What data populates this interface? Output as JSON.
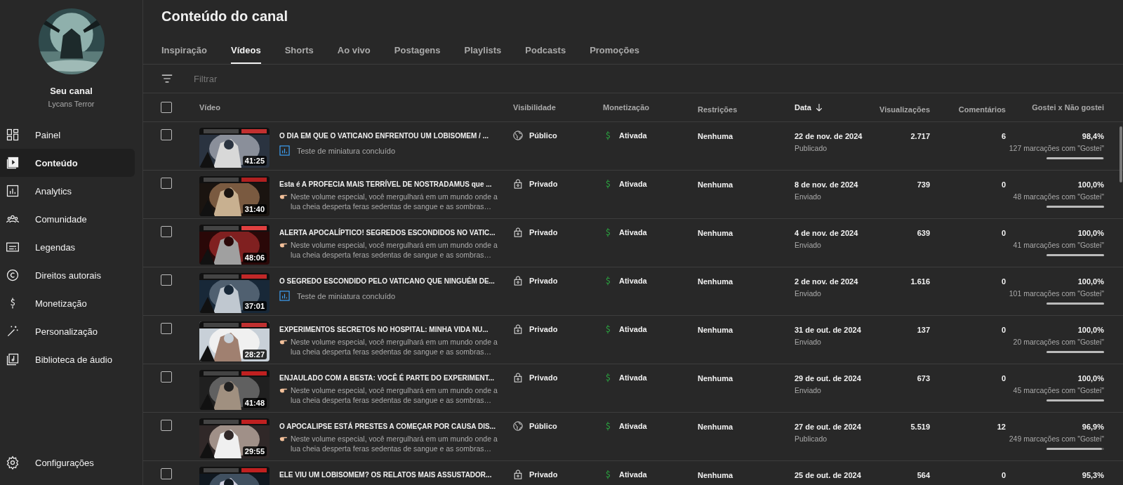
{
  "channel": {
    "label": "Seu canal",
    "name": "Lycans Terror"
  },
  "nav": [
    {
      "label": "Painel",
      "kind": "dashboard",
      "selected": false
    },
    {
      "label": "Conteúdo",
      "kind": "content",
      "selected": true
    },
    {
      "label": "Analytics",
      "kind": "analytics",
      "selected": false
    },
    {
      "label": "Comunidade",
      "kind": "community",
      "selected": false
    },
    {
      "label": "Legendas",
      "kind": "subtitles",
      "selected": false
    },
    {
      "label": "Direitos autorais",
      "kind": "copyright",
      "selected": false
    },
    {
      "label": "Monetização",
      "kind": "money",
      "selected": false
    },
    {
      "label": "Personalização",
      "kind": "wand",
      "selected": false
    },
    {
      "label": "Biblioteca de áudio",
      "kind": "audio",
      "selected": false
    }
  ],
  "settings": {
    "label": "Configurações"
  },
  "page_title": "Conteúdo do canal",
  "tabs": [
    {
      "label": "Inspiração",
      "selected": false
    },
    {
      "label": "Vídeos",
      "selected": true
    },
    {
      "label": "Shorts",
      "selected": false
    },
    {
      "label": "Ao vivo",
      "selected": false
    },
    {
      "label": "Postagens",
      "selected": false
    },
    {
      "label": "Playlists",
      "selected": false
    },
    {
      "label": "Podcasts",
      "selected": false
    },
    {
      "label": "Promoções",
      "selected": false
    }
  ],
  "filter": {
    "placeholder": "Filtrar"
  },
  "table": {
    "header_checked": false,
    "columns": [
      {
        "label": "Vídeo",
        "sorted": false
      },
      {
        "label": "Visibilidade",
        "sorted": false
      },
      {
        "label": "Monetização",
        "sorted": false
      },
      {
        "label": "Restrições",
        "sorted": false
      },
      {
        "label": "Data",
        "sorted": true
      },
      {
        "label": "Visualizações",
        "sorted": false
      },
      {
        "label": "Comentários",
        "sorted": false
      },
      {
        "label": "Gostei x Não gostei",
        "sorted": false
      }
    ],
    "rows": [
      {
        "checked": false,
        "duration": "41:25",
        "title": "O DIA EM QUE O VATICANO ENFRENTOU UM LOBISOMEM / ...",
        "sub": {
          "kind": "test",
          "text": "Teste de miniatura concluído"
        },
        "visibility": {
          "kind": "public",
          "label": "Público"
        },
        "monetization": "Ativada",
        "restrictions": "Nenhuma",
        "date": "22 de nov. de 2024",
        "status": "Publicado",
        "views": "2.717",
        "comments": "6",
        "likes_pct": "98,4%",
        "likes_count": "127 marcações com \"Gostei\"",
        "level": 0.984
      },
      {
        "checked": false,
        "duration": "31:40",
        "title": "Esta é A PROFECIA MAIS TERRÍVEL DE NOSTRADAMUS que ...",
        "sub": {
          "kind": "description",
          "text": "Neste volume especial, você mergulhará em um mundo onde a lua cheia desperta feras sedentas de sangue e as sombras…"
        },
        "visibility": {
          "kind": "private",
          "label": "Privado"
        },
        "monetization": "Ativada",
        "restrictions": "Nenhuma",
        "date": "8 de nov. de 2024",
        "status": "Enviado",
        "views": "739",
        "comments": "0",
        "likes_pct": "100,0%",
        "likes_count": "48 marcações com \"Gostei\"",
        "level": 1
      },
      {
        "checked": false,
        "duration": "48:06",
        "title": "ALERTA APOCALÍPTICO! SEGREDOS ESCONDIDOS NO VATIC...",
        "sub": {
          "kind": "description",
          "text": "Neste volume especial, você mergulhará em um mundo onde a lua cheia desperta feras sedentas de sangue e as sombras…"
        },
        "visibility": {
          "kind": "private",
          "label": "Privado"
        },
        "monetization": "Ativada",
        "restrictions": "Nenhuma",
        "date": "4 de nov. de 2024",
        "status": "Enviado",
        "views": "639",
        "comments": "0",
        "likes_pct": "100,0%",
        "likes_count": "41 marcações com \"Gostei\"",
        "level": 1
      },
      {
        "checked": false,
        "duration": "37:01",
        "title": "O SEGREDO ESCONDIDO PELO VATICANO QUE NINGUÉM DE...",
        "sub": {
          "kind": "test",
          "text": "Teste de miniatura concluído"
        },
        "visibility": {
          "kind": "private",
          "label": "Privado"
        },
        "monetization": "Ativada",
        "restrictions": "Nenhuma",
        "date": "2 de nov. de 2024",
        "status": "Enviado",
        "views": "1.616",
        "comments": "0",
        "likes_pct": "100,0%",
        "likes_count": "101 marcações com \"Gostei\"",
        "level": 1
      },
      {
        "checked": false,
        "duration": "28:27",
        "title": "EXPERIMENTOS SECRETOS NO HOSPITAL: MINHA VIDA NU...",
        "sub": {
          "kind": "description",
          "text": "Neste volume especial, você mergulhará em um mundo onde a lua cheia desperta feras sedentas de sangue e as sombras…"
        },
        "visibility": {
          "kind": "private",
          "label": "Privado"
        },
        "monetization": "Ativada",
        "restrictions": "Nenhuma",
        "date": "31 de out. de 2024",
        "status": "Enviado",
        "views": "137",
        "comments": "0",
        "likes_pct": "100,0%",
        "likes_count": "20 marcações com \"Gostei\"",
        "level": 1
      },
      {
        "checked": false,
        "duration": "41:48",
        "title": "ENJAULADO COM A BESTA: VOCÊ É PARTE DO EXPERIMENT...",
        "sub": {
          "kind": "description",
          "text": "Neste volume especial, você mergulhará em um mundo onde a lua cheia desperta feras sedentas de sangue e as sombras…"
        },
        "visibility": {
          "kind": "private",
          "label": "Privado"
        },
        "monetization": "Ativada",
        "restrictions": "Nenhuma",
        "date": "29 de out. de 2024",
        "status": "Enviado",
        "views": "673",
        "comments": "0",
        "likes_pct": "100,0%",
        "likes_count": "45 marcações com \"Gostei\"",
        "level": 1
      },
      {
        "checked": false,
        "duration": "29:55",
        "title": "O APOCALIPSE ESTÁ PRESTES A COMEÇAR POR CAUSA DIS...",
        "sub": {
          "kind": "description",
          "text": "Neste volume especial, você mergulhará em um mundo onde a lua cheia desperta feras sedentas de sangue e as sombras…"
        },
        "visibility": {
          "kind": "public",
          "label": "Público"
        },
        "monetization": "Ativada",
        "restrictions": "Nenhuma",
        "date": "27 de out. de 2024",
        "status": "Publicado",
        "views": "5.519",
        "comments": "12",
        "likes_pct": "96,9%",
        "likes_count": "249 marcações com \"Gostei\"",
        "level": 0.969
      },
      {
        "checked": false,
        "title": "ELE VIU UM LOBISOMEM? OS RELATOS MAIS ASSUSTADOR...",
        "visibility": {
          "kind": "private",
          "label": "Privado"
        },
        "monetization": "Ativada",
        "restrictions": "Nenhuma",
        "date": "25 de out. de 2024",
        "views": "564",
        "comments": "0",
        "likes_pct": "95,3%"
      }
    ]
  }
}
